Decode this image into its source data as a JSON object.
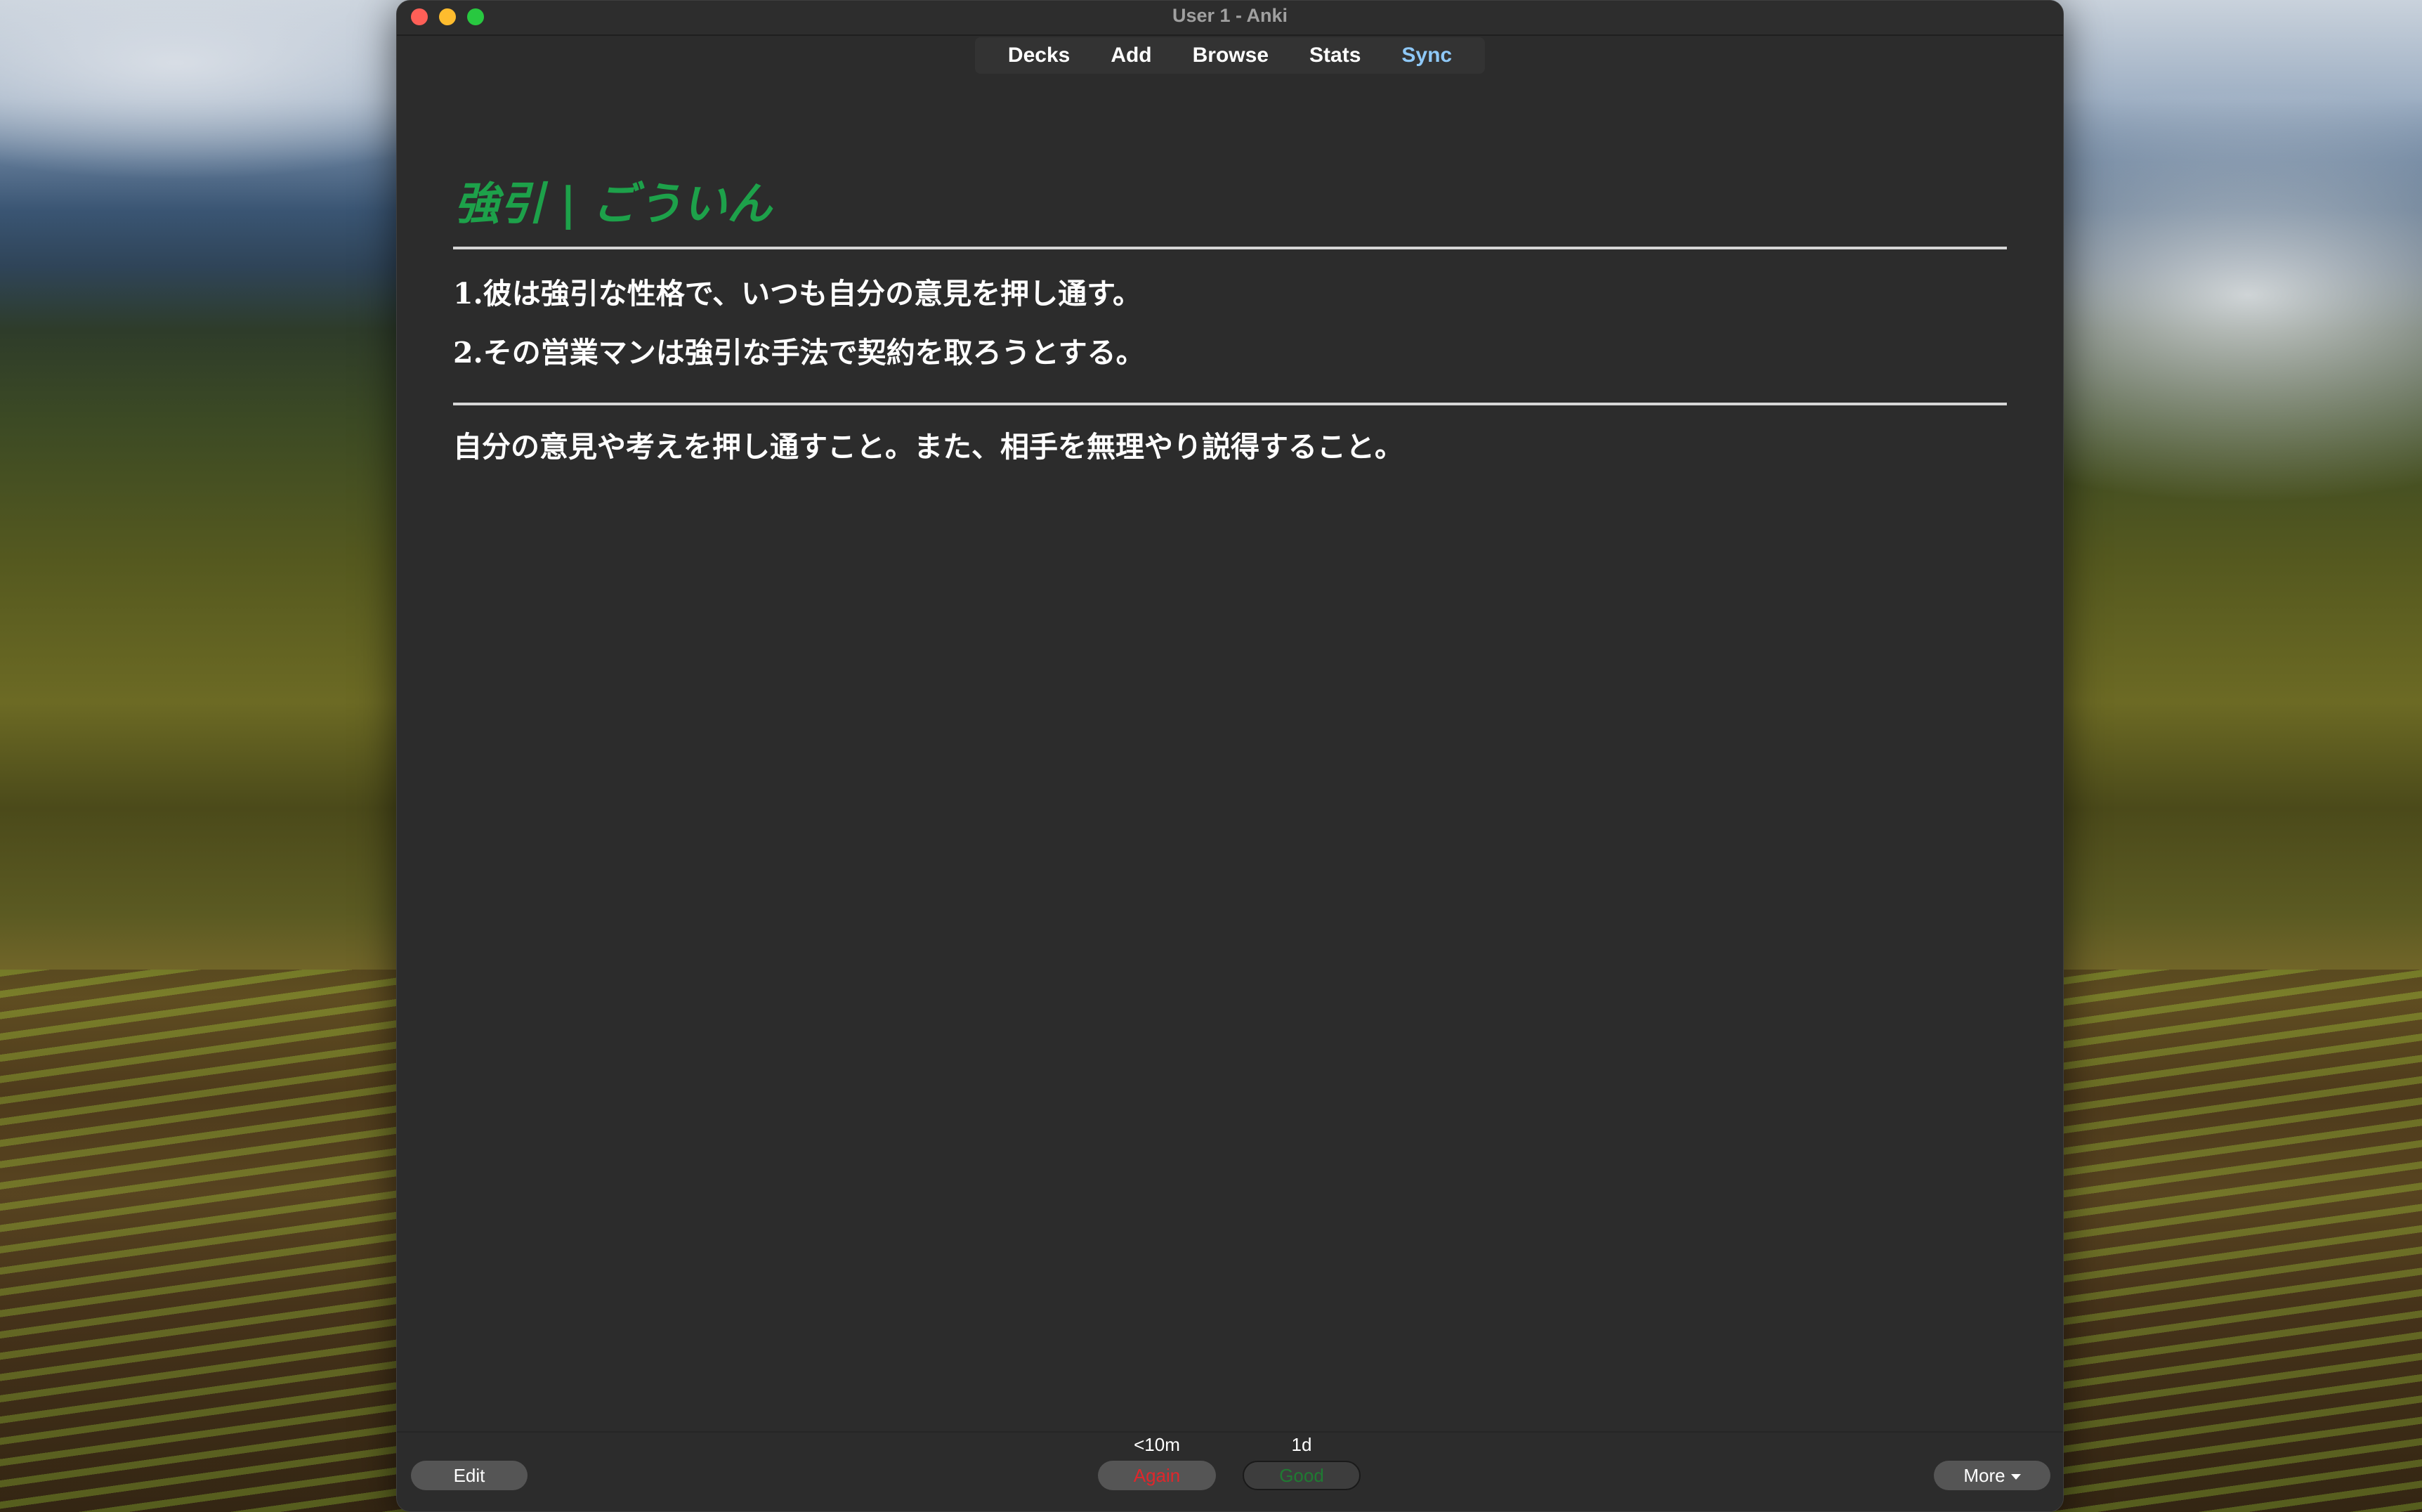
{
  "window": {
    "title": "User 1 - Anki"
  },
  "toolbar": {
    "items": [
      {
        "label": "Decks"
      },
      {
        "label": "Add"
      },
      {
        "label": "Browse"
      },
      {
        "label": "Stats"
      },
      {
        "label": "Sync"
      }
    ]
  },
  "card": {
    "title": "強引 | ごういん",
    "examples": [
      "1.彼は強引な性格で、いつも自分の意見を押し通す。",
      "2.その営業マンは強引な手法で契約を取ろうとする。"
    ],
    "definition": "自分の意見や考えを押し通すこと。また、相手を無理やり説得すること。"
  },
  "bottombar": {
    "edit_label": "Edit",
    "more_label": "More",
    "again": {
      "interval": "<10m",
      "label": "Again"
    },
    "good": {
      "interval": "1d",
      "label": "Good"
    }
  },
  "colors": {
    "title_green": "#1da14a",
    "sync_blue": "#8ec8f7",
    "again_red": "#e0262b",
    "good_green": "#1f7a32"
  }
}
